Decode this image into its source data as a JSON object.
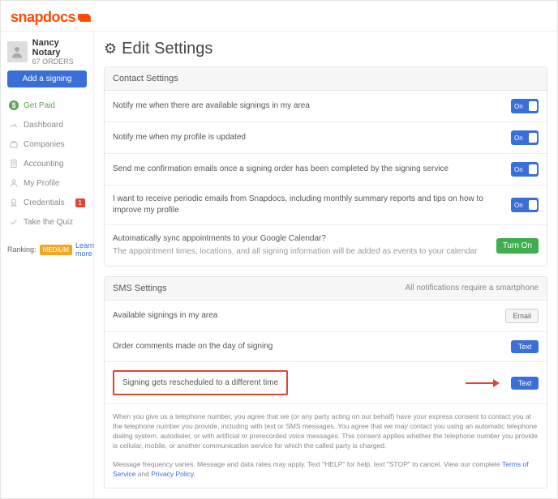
{
  "brand": {
    "name": "snapdocs"
  },
  "user": {
    "name": "Nancy Notary",
    "orders_line": "67 ORDERS"
  },
  "sidebar": {
    "add_signing": "Add a signing",
    "items": [
      {
        "label": "Get Paid"
      },
      {
        "label": "Dashboard"
      },
      {
        "label": "Companies"
      },
      {
        "label": "Accounting"
      },
      {
        "label": "My Profile"
      },
      {
        "label": "Credentials",
        "badge": "1"
      },
      {
        "label": "Take the Quiz"
      }
    ],
    "ranking_label": "Ranking:",
    "ranking_value": "MEDIUM",
    "learn_more": "Learn more"
  },
  "page": {
    "title": "Edit Settings"
  },
  "contact_panel": {
    "title": "Contact Settings",
    "rows": [
      {
        "text": "Notify me when there are available signings in my area",
        "toggle": "On"
      },
      {
        "text": "Notify me when my profile is updated",
        "toggle": "On"
      },
      {
        "text": "Send me confirmation emails once a signing order has been completed by the signing service",
        "toggle": "On"
      },
      {
        "text": "I want to receive periodic emails from Snapdocs, including monthly summary reports and tips on how to improve my profile",
        "toggle": "On"
      }
    ],
    "calendar": {
      "title": "Automatically sync appointments to your Google Calendar?",
      "sub": "The appointment times, locations, and all signing information will be added as events to your calendar",
      "button": "Turn On"
    }
  },
  "sms_panel": {
    "title": "SMS Settings",
    "meta": "All notifications require a smartphone",
    "rows": [
      {
        "text": "Available signings in my area",
        "button": "Email"
      },
      {
        "text": "Order comments made on the day of signing",
        "button": "Text"
      },
      {
        "text": "Signing gets rescheduled to a different time",
        "button": "Text"
      }
    ],
    "legal1": "When you give us a telephone number, you agree that we (or any party acting on our behalf) have your express consent to contact you at the telephone number you provide, including with text or SMS messages. You agree that we may contact you using an automatic telephone dialing system, autodialer, or with artificial or prerecorded voice messages. This consent applies whether the telephone number you provide is cellular, mobile, or another communication service for which the called party is charged.",
    "legal2_pre": "Message frequency varies. Message and data rates may apply. Text \"HELP\" for help, text \"STOP\" to cancel. View our complete ",
    "tos": "Terms of Service",
    "and": " and ",
    "privacy": "Privacy Policy",
    "period": "."
  }
}
